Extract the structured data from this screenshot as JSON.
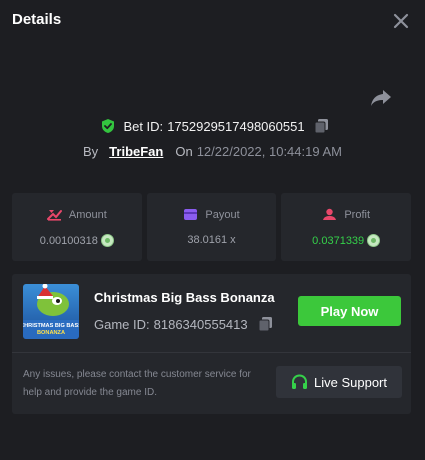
{
  "header": {
    "title": "Details",
    "close_icon": "close-icon"
  },
  "bet": {
    "id_label": "Bet ID:",
    "id": "1752929517498060551",
    "by_label": "By",
    "user": "TribeFan",
    "on_label": "On",
    "date": "12/22/2022, 10:44:19 AM"
  },
  "stats": [
    {
      "label": "Amount",
      "value": "0.00100318",
      "icon": "amount-icon",
      "color": "#9fa2ab"
    },
    {
      "label": "Payout",
      "value": "38.0161 x",
      "icon": "payout-icon",
      "color": "#9fa2ab"
    },
    {
      "label": "Profit",
      "value": "0.0371339",
      "icon": "profit-icon",
      "color": "#35d14a"
    }
  ],
  "game": {
    "name": "Christmas Big Bass Bonanza",
    "id_label": "Game ID:",
    "id": "8186340555413",
    "thumb_text": "CHRISTMAS BIG BASS BONANZA",
    "play_label": "Play Now"
  },
  "support": {
    "notice": "Any issues, please contact the customer service for help and provide the game ID.",
    "button_label": "Live Support"
  },
  "colors": {
    "background": "#1d1e22",
    "card": "#25272c",
    "accent_green": "#3cc83b",
    "profit_green": "#35d14a"
  }
}
